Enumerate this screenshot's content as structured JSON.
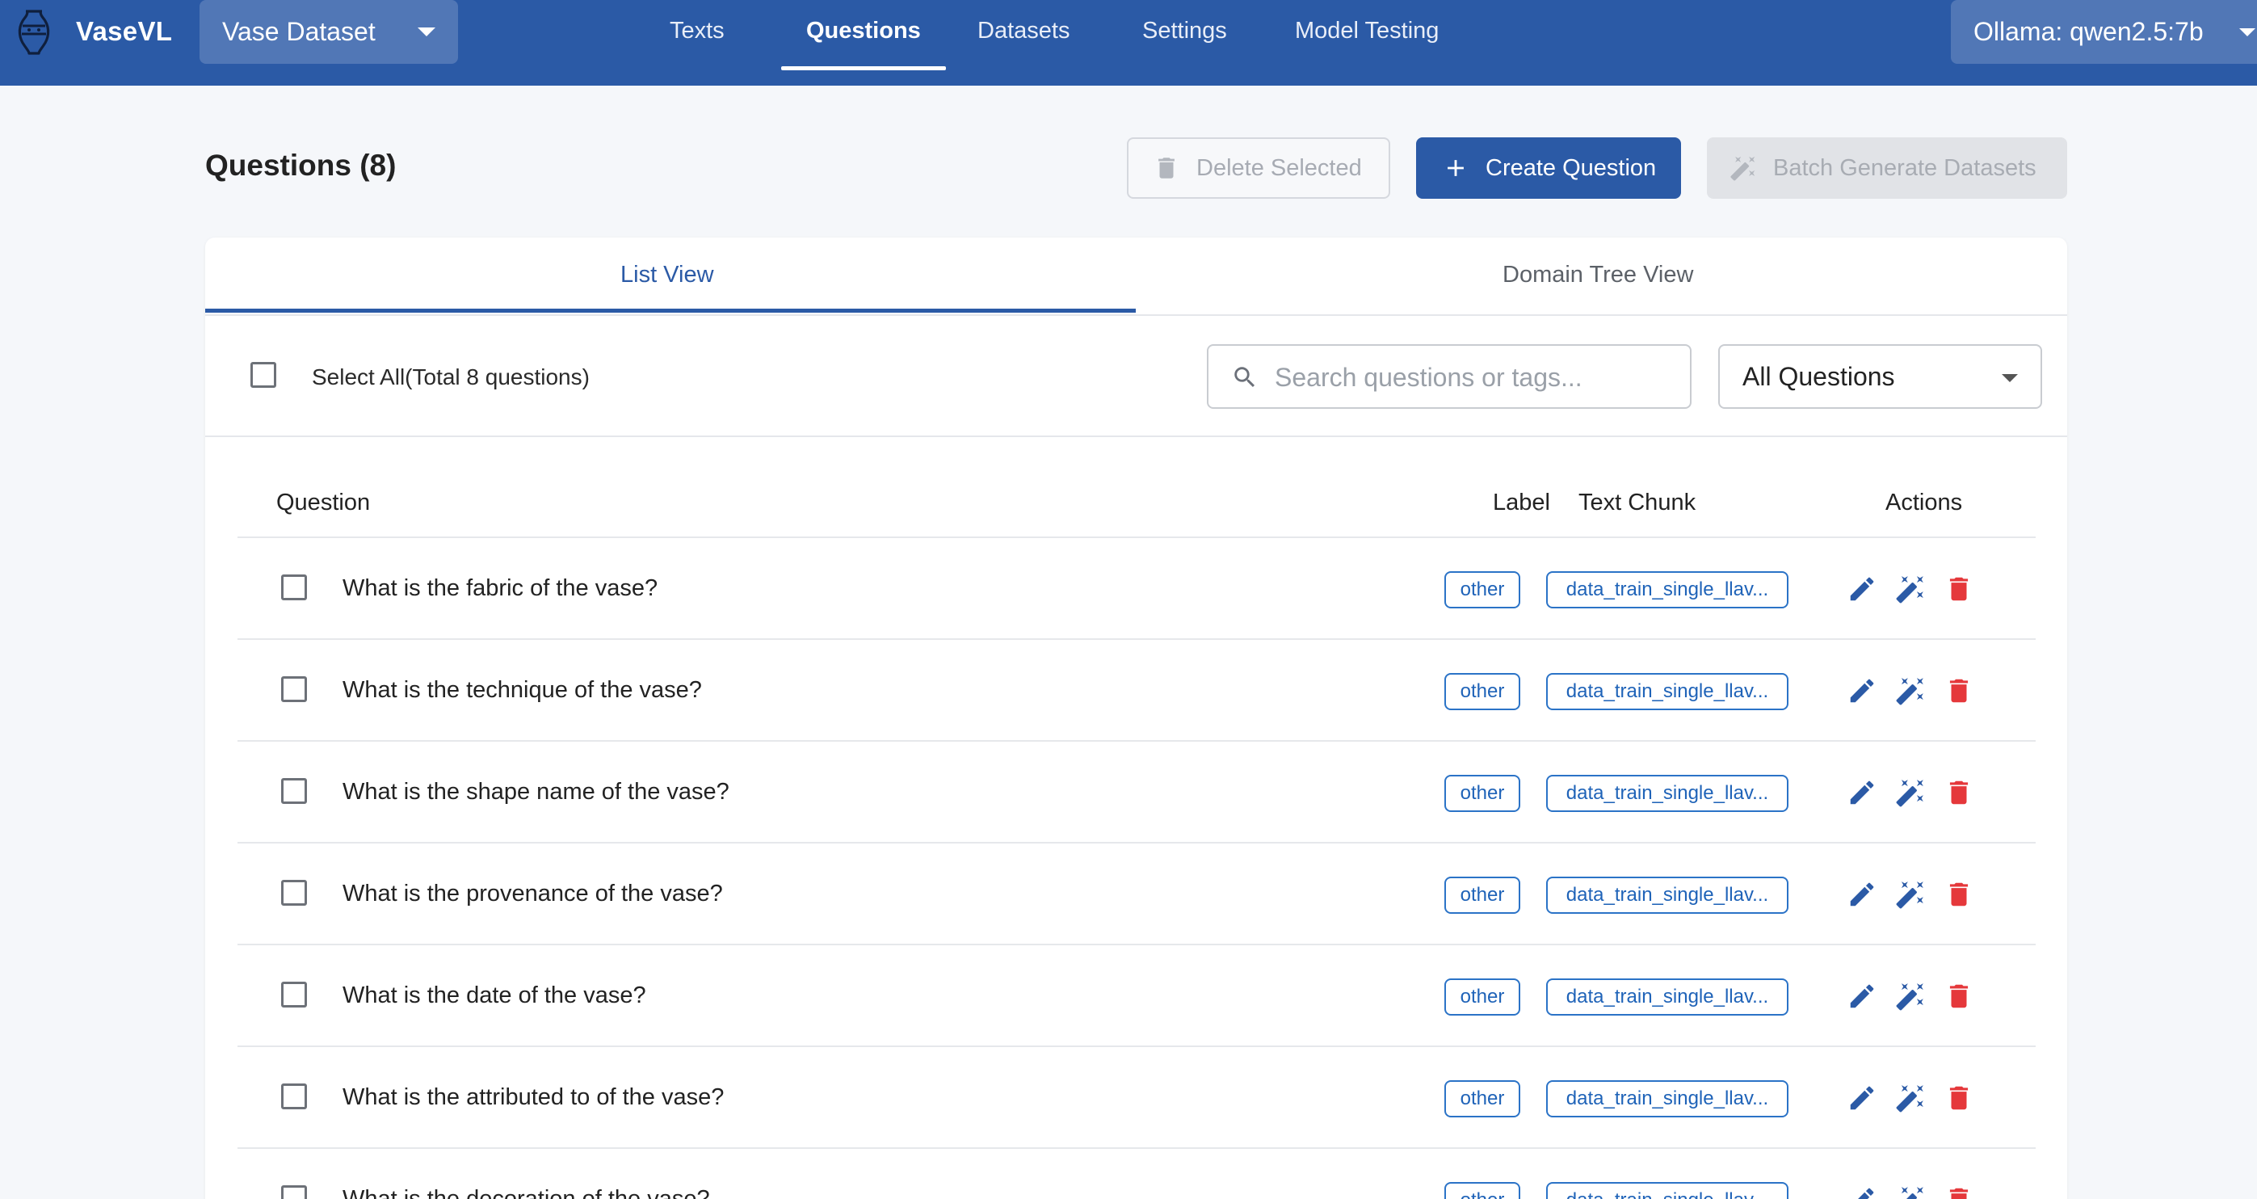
{
  "app": {
    "name": "VaseVL",
    "project": "Vase Dataset",
    "model": "Ollama: qwen2.5:7b"
  },
  "nav": [
    {
      "label": "Texts",
      "active": false
    },
    {
      "label": "Questions",
      "active": true
    },
    {
      "label": "Datasets",
      "active": false
    },
    {
      "label": "Settings",
      "active": false
    },
    {
      "label": "Model Testing",
      "active": false
    }
  ],
  "page": {
    "title": "Questions (8)",
    "delete_label": "Delete Selected",
    "create_label": "Create Question",
    "batch_label": "Batch Generate Datasets"
  },
  "tabs": {
    "list": "List View",
    "tree": "Domain Tree View"
  },
  "toolbar": {
    "select_all": "Select All(Total 8 questions)",
    "search_placeholder": "Search questions or tags...",
    "filter": "All Questions"
  },
  "table": {
    "headers": {
      "question": "Question",
      "label": "Label",
      "chunk": "Text Chunk",
      "actions": "Actions"
    },
    "rows": [
      {
        "question": "What is the fabric of the vase?",
        "label": "other",
        "chunk": "data_train_single_llav..."
      },
      {
        "question": "What is the technique of the vase?",
        "label": "other",
        "chunk": "data_train_single_llav..."
      },
      {
        "question": "What is the shape name of the vase?",
        "label": "other",
        "chunk": "data_train_single_llav..."
      },
      {
        "question": "What is the provenance of the vase?",
        "label": "other",
        "chunk": "data_train_single_llav..."
      },
      {
        "question": "What is the date of the vase?",
        "label": "other",
        "chunk": "data_train_single_llav..."
      },
      {
        "question": "What is the attributed to of the vase?",
        "label": "other",
        "chunk": "data_train_single_llav..."
      },
      {
        "question": "What is the decoration of the vase?",
        "label": "other",
        "chunk": "data_train_single_llav..."
      }
    ]
  },
  "icons": {
    "logo": "vase-icon",
    "search": "search-icon",
    "delete": "trash-icon",
    "create": "plus-icon",
    "batch": "magic-wand-icon",
    "row_edit": "pencil-icon",
    "row_generate": "magic-wand-icon",
    "row_delete": "trash-icon"
  },
  "colors": {
    "primary": "#2b5aa6",
    "chip": "#2b73c7",
    "danger": "#e5383b",
    "background": "#f5f7fa"
  }
}
